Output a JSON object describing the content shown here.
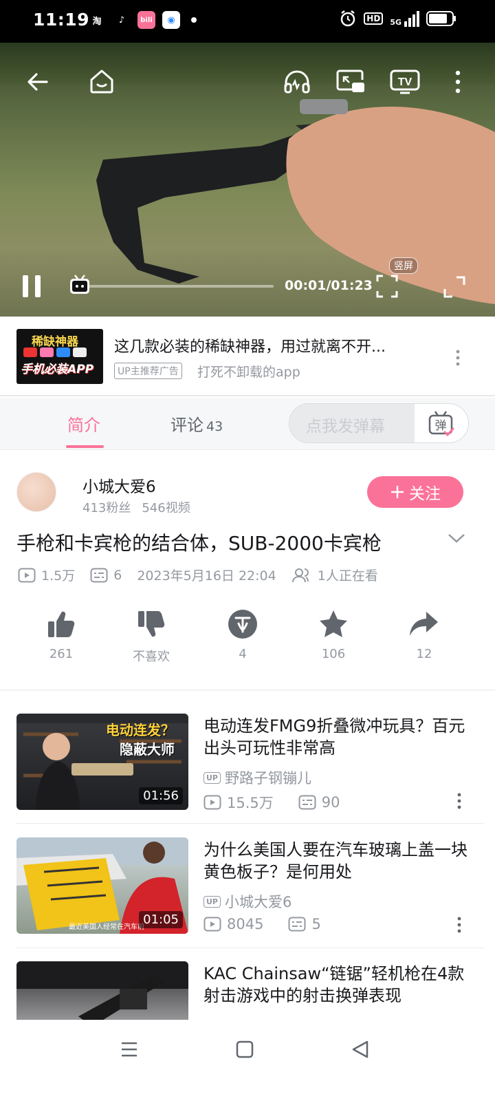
{
  "status_bar": {
    "time": "11:19",
    "apps": [
      {
        "label": "淘",
        "color": "#000000"
      },
      {
        "label": "♪",
        "color": "#000000"
      },
      {
        "label": "bili",
        "color": "#fb7299"
      },
      {
        "label": "◉",
        "color": "#2f8cff"
      }
    ],
    "network": "5G",
    "hd": "HD"
  },
  "player": {
    "current_time": "00:01/01:23",
    "progress_fraction": 0.02,
    "vertical_label": "竖屏"
  },
  "ad": {
    "thumb_line1": "稀缺神器",
    "thumb_line2": "手机必装APP",
    "title": "这几款必装的稀缺神器，用过就离不开...",
    "tag": "UP主推荐广告",
    "subtitle": "打死不卸载的app"
  },
  "tabs": {
    "intro": "简介",
    "comments": "评论",
    "comments_count": "43",
    "danmaku_placeholder": "点我发弹幕",
    "danmaku_btn": "弹"
  },
  "uploader": {
    "name": "小城大爱6",
    "fans": "413粉丝",
    "videos": "546视频",
    "follow": "关注"
  },
  "video": {
    "title": "手枪和卡宾枪的结合体，SUB-2000卡宾枪",
    "views": "1.5万",
    "danmaku": "6",
    "date": "2023年5月16日 22:04",
    "watching": "1人正在看"
  },
  "actions": {
    "like": "261",
    "dislike": "不喜欢",
    "coin": "4",
    "favorite": "106",
    "share": "12"
  },
  "recommendations": [
    {
      "title": "电动连发FMG9折叠微冲玩具？百元出头可玩性非常高",
      "up": "野路子钢镚儿",
      "views": "15.5万",
      "danmaku": "90",
      "duration": "01:56",
      "thumb_caption": "电动连发？",
      "thumb_caption2": "隐蔽大师"
    },
    {
      "title": "为什么美国人要在汽车玻璃上盖一块黄色板子？是何用处",
      "up": "小城大爱6",
      "views": "8045",
      "danmaku": "5",
      "duration": "01:05",
      "thumb_caption": "最近美国人经常在汽车前"
    },
    {
      "title": "KAC Chainsaw“链锯”轻机枪在4款射击游戏中的射击换弹表现"
    }
  ],
  "up_badge": "UP",
  "colors": {
    "accent": "#fb7299",
    "secondary_text": "#9499a0"
  }
}
